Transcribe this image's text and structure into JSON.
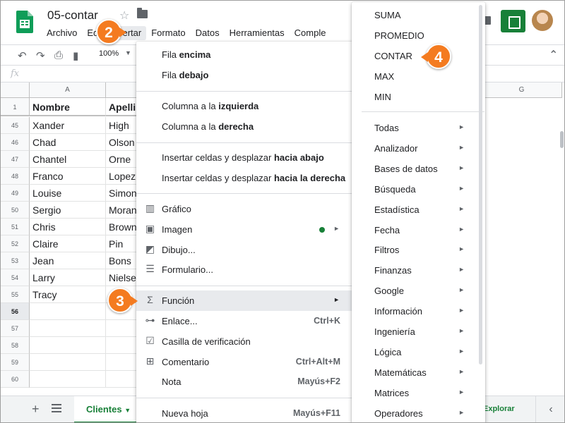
{
  "app": {
    "doc_title": "05-contar",
    "menubar": [
      "Archivo",
      "Edi",
      "Insertar",
      "Formato",
      "Datos",
      "Herramientas",
      "Comple"
    ],
    "active_menu_index": 2
  },
  "toolbar": {
    "zoom": "100%"
  },
  "grid": {
    "columns": [
      {
        "label": "A"
      },
      {
        "label": ""
      },
      {
        "label": "G"
      }
    ],
    "header_row": {
      "num": "1",
      "a": "Nombre",
      "b": "Apelli"
    },
    "rows": [
      {
        "num": "45",
        "a": "Xander",
        "b": "High"
      },
      {
        "num": "46",
        "a": "Chad",
        "b": "Olson"
      },
      {
        "num": "47",
        "a": "Chantel",
        "b": "Orne"
      },
      {
        "num": "48",
        "a": "Franco",
        "b": "Lopez"
      },
      {
        "num": "49",
        "a": "Louise",
        "b": "Simon"
      },
      {
        "num": "50",
        "a": "Sergio",
        "b": "Moran"
      },
      {
        "num": "51",
        "a": "Chris",
        "b": "Brown"
      },
      {
        "num": "52",
        "a": "Claire",
        "b": "Pin"
      },
      {
        "num": "53",
        "a": "Jean",
        "b": "Bons"
      },
      {
        "num": "54",
        "a": "Larry",
        "b": "Nielse"
      },
      {
        "num": "55",
        "a": "Tracy",
        "b": ""
      },
      {
        "num": "56",
        "a": "",
        "b": ""
      },
      {
        "num": "57",
        "a": "",
        "b": ""
      },
      {
        "num": "58",
        "a": "",
        "b": ""
      },
      {
        "num": "59",
        "a": "",
        "b": ""
      },
      {
        "num": "60",
        "a": "",
        "b": ""
      }
    ]
  },
  "insert_menu": {
    "items": [
      {
        "pre": "Fila ",
        "bold": "encima"
      },
      {
        "pre": "Fila ",
        "bold": "debajo"
      },
      {
        "pre": "Columna a la ",
        "bold": "izquierda"
      },
      {
        "pre": "Columna a la ",
        "bold": "derecha"
      },
      {
        "pre": "Insertar celdas y desplazar ",
        "bold": "hacia abajo"
      },
      {
        "pre": "Insertar celdas y desplazar ",
        "bold": "hacia la derecha"
      },
      {
        "label": "Gráfico",
        "icon": "chart-icon"
      },
      {
        "label": "Imagen",
        "icon": "image-icon"
      },
      {
        "label": "Dibujo...",
        "icon": "drawing-icon"
      },
      {
        "label": "Formulario...",
        "icon": "form-icon"
      },
      {
        "label": "Función",
        "icon": "sigma-icon"
      },
      {
        "label": "Enlace...",
        "icon": "link-icon",
        "shortcut": "Ctrl+K"
      },
      {
        "label": "Casilla de verificación",
        "icon": "checkbox-icon"
      },
      {
        "label": "Comentario",
        "icon": "comment-icon",
        "shortcut": "Ctrl+Alt+M"
      },
      {
        "label": "Nota",
        "shortcut": "Mayús+F2"
      },
      {
        "label": "Nueva hoja",
        "shortcut": "Mayús+F11"
      }
    ]
  },
  "function_menu": {
    "items": [
      "SUMA",
      "PROMEDIO",
      "CONTAR",
      "MAX",
      "MIN"
    ],
    "categories": [
      "Todas",
      "Analizador",
      "Bases de datos",
      "Búsqueda",
      "Estadística",
      "Fecha",
      "Filtros",
      "Finanzas",
      "Google",
      "Información",
      "Ingeniería",
      "Lógica",
      "Matemáticas",
      "Matrices",
      "Operadores"
    ]
  },
  "callouts": [
    "2",
    "3",
    "4"
  ],
  "bottom": {
    "sheet_tab": "Clientes",
    "explore": "Explorar"
  },
  "colors": {
    "accent": "#188038",
    "callout": "#f47b20",
    "highlight": "#e8eaed"
  }
}
